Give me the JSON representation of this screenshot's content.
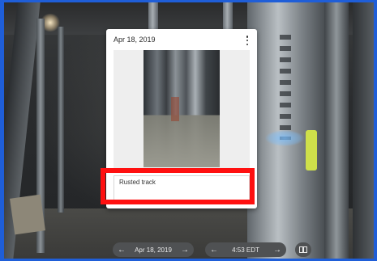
{
  "card": {
    "date": "Apr 18, 2019",
    "menu_icon": "more-vert-icon",
    "caption": "Rusted track"
  },
  "controls": {
    "date_label": "Apr 18, 2019",
    "time_label": "4:53 EDT",
    "prev_icon": "arrow-left-icon",
    "next_icon": "arrow-right-icon",
    "layout_icon": "split-view-icon"
  },
  "colors": {
    "frame": "#1f5ed8",
    "highlight": "#ff1010",
    "pill": "#4f5153"
  }
}
